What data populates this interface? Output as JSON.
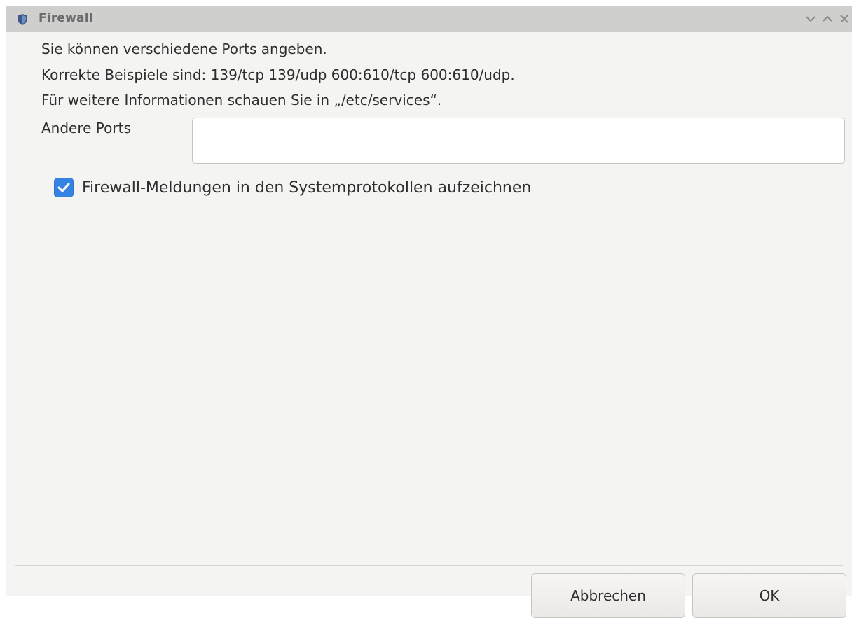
{
  "window": {
    "title": "Firewall"
  },
  "info": {
    "line1": "Sie können verschiedene Ports angeben.",
    "line2": "Korrekte Beispiele sind: 139/tcp 139/udp 600:610/tcp 600:610/udp.",
    "line3": "Für weitere Informationen schauen Sie in „/etc/services“."
  },
  "ports": {
    "label": "Andere Ports",
    "value": "",
    "placeholder": ""
  },
  "logging": {
    "label": "Firewall-Meldungen in den Systemprotokollen aufzeichnen",
    "checked": true
  },
  "buttons": {
    "cancel": "Abbrechen",
    "ok": "OK"
  },
  "icons": {
    "window": "shield-icon",
    "minimize": "chevron-down-icon",
    "maximize": "chevron-up-icon",
    "close": "close-icon",
    "check": "checkmark-icon"
  },
  "colors": {
    "accent": "#3584e4",
    "titlebar": "#cfcfcd",
    "background": "#f4f4f2"
  }
}
